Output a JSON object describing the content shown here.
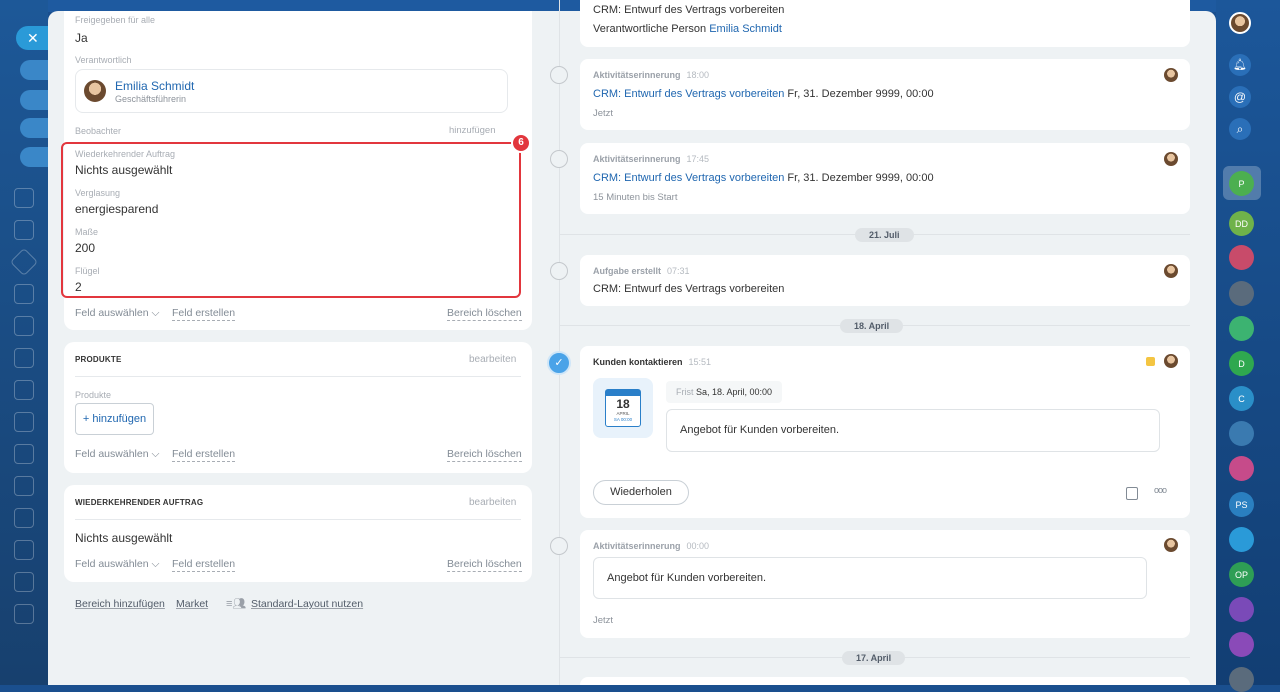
{
  "left_card": {
    "shared_label": "Freigegeben für alle",
    "shared_value": "Ja",
    "responsible_label": "Verantwortlich",
    "responsible_name": "Emilia Schmidt",
    "responsible_role": "Geschäftsführerin",
    "observers_label": "Beobachter",
    "observers_add": "hinzufügen",
    "badge": "6",
    "fields": [
      {
        "label": "Wiederkehrender Auftrag",
        "value": "Nichts ausgewählt"
      },
      {
        "label": "Verglasung",
        "value": "energiesparend"
      },
      {
        "label": "Maße",
        "value": "200"
      },
      {
        "label": "Flügel",
        "value": "2"
      }
    ],
    "select_field": "Feld auswählen",
    "create_field": "Feld erstellen",
    "delete_section": "Bereich löschen"
  },
  "products_card": {
    "title": "PRODUKTE",
    "edit": "bearbeiten",
    "products_label": "Produkte",
    "add_button": "+ hinzufügen",
    "select_field": "Feld auswählen",
    "create_field": "Feld erstellen",
    "delete_section": "Bereich löschen"
  },
  "recurring_card": {
    "title": "WIEDERKEHRENDER AUFTRAG",
    "edit": "bearbeiten",
    "value": "Nichts ausgewählt",
    "select_field": "Feld auswählen",
    "create_field": "Feld erstellen",
    "delete_section": "Bereich löschen"
  },
  "footer_links": {
    "add_section": "Bereich hinzufügen",
    "market": "Market",
    "default_layout": "Standard-Layout nutzen"
  },
  "timeline": {
    "top_card": {
      "link_partial": "CRM: Entwurf des Vertrags vorbereiten",
      "person_label": "Verantwortliche Person",
      "person_name": "Emilia Schmidt"
    },
    "reminder1": {
      "title": "Aktivitätserinnerung",
      "time": "18:00",
      "link": "CRM: Entwurf des Vertrags vorbereiten",
      "date": "Fr, 31. Dezember 9999, 00:00",
      "sub": "Jetzt"
    },
    "reminder2": {
      "title": "Aktivitätserinnerung",
      "time": "17:45",
      "link": "CRM: Entwurf des Vertrags vorbereiten",
      "date": "Fr, 31. Dezember 9999, 00:00",
      "sub": "15 Minuten bis Start"
    },
    "date_july": "21. Juli",
    "task_created": {
      "title": "Aufgabe erstellt",
      "time": "07:31",
      "link": "CRM: Entwurf des Vertrags vorbereiten"
    },
    "date_april18": "18. April",
    "contact": {
      "title": "Kunden kontaktieren",
      "time": "15:51",
      "cal_day": "18",
      "cal_month": "APRIL",
      "cal_time": "SA 00:00",
      "deadline_label": "Frist",
      "deadline_value": "Sa, 18. April, 00:00",
      "text": "Angebot für Kunden vorbereiten.",
      "repeat_button": "Wiederholen",
      "more": "ooo"
    },
    "reminder3": {
      "title": "Aktivitätserinnerung",
      "time": "00:00",
      "text": "Angebot für Kunden vorbereiten.",
      "sub": "Jetzt"
    },
    "date_april17": "17. April"
  },
  "right_rail": {
    "items": [
      "P",
      "DD",
      "D",
      "C",
      "PS",
      "OP"
    ]
  },
  "colors": {
    "accent": "#2067b0",
    "highlight_border": "#e2363d",
    "rail_bg": "#1c579a"
  }
}
